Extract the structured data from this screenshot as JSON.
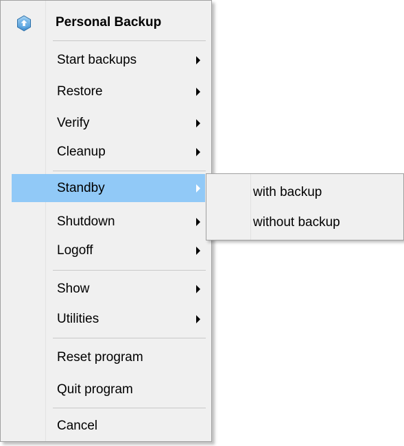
{
  "menu": {
    "title": "Personal Backup",
    "icon": "personal-backup-app-icon",
    "items": [
      {
        "label": "Start backups",
        "has_submenu": true
      },
      {
        "label": "Restore",
        "has_submenu": true
      },
      {
        "label": "Verify",
        "has_submenu": true
      },
      {
        "label": "Cleanup",
        "has_submenu": true
      },
      {
        "label": "Standby",
        "has_submenu": true,
        "highlighted": true
      },
      {
        "label": "Shutdown",
        "has_submenu": true
      },
      {
        "label": "Logoff",
        "has_submenu": true
      },
      {
        "label": "Show",
        "has_submenu": true
      },
      {
        "label": "Utilities",
        "has_submenu": true
      },
      {
        "label": "Reset program",
        "has_submenu": false
      },
      {
        "label": "Quit program",
        "has_submenu": false
      },
      {
        "label": "Cancel",
        "has_submenu": false
      }
    ]
  },
  "submenu": {
    "items": [
      {
        "label": "with backup"
      },
      {
        "label": "without backup"
      }
    ]
  },
  "colors": {
    "menu_background": "#f0f0f0",
    "highlight": "#91c9f7",
    "border": "#a0a0a0"
  }
}
